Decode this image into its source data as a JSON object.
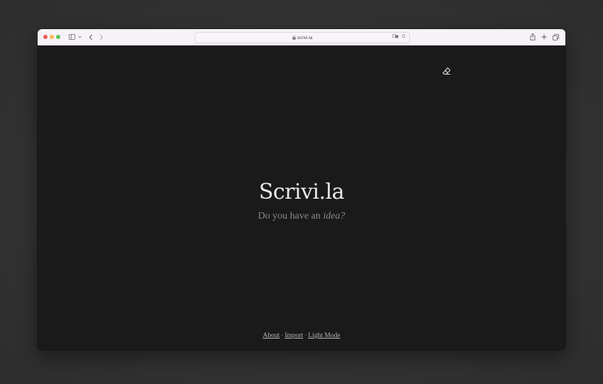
{
  "browser": {
    "url": "scrivi.la",
    "icons": [
      "sidebar-icon",
      "chevron-down-icon",
      "back-icon",
      "forward-icon",
      "lock-icon",
      "translate-icon",
      "reload-icon",
      "share-icon",
      "new-tab-icon",
      "tabs-overview-icon"
    ]
  },
  "page": {
    "title": "Scrivi.la",
    "subtitle_prefix": "Do you have an",
    "subtitle_emphasis": "idea?",
    "eraser_icon": "eraser-icon"
  },
  "footer": {
    "links": [
      "About",
      "Import",
      "Light Mode"
    ],
    "separator": "·"
  },
  "colors": {
    "background": "#1a1a1a",
    "title": "#e8e8e8",
    "subtitle": "#8a8a8a",
    "toolbar": "#f7f1f8"
  }
}
